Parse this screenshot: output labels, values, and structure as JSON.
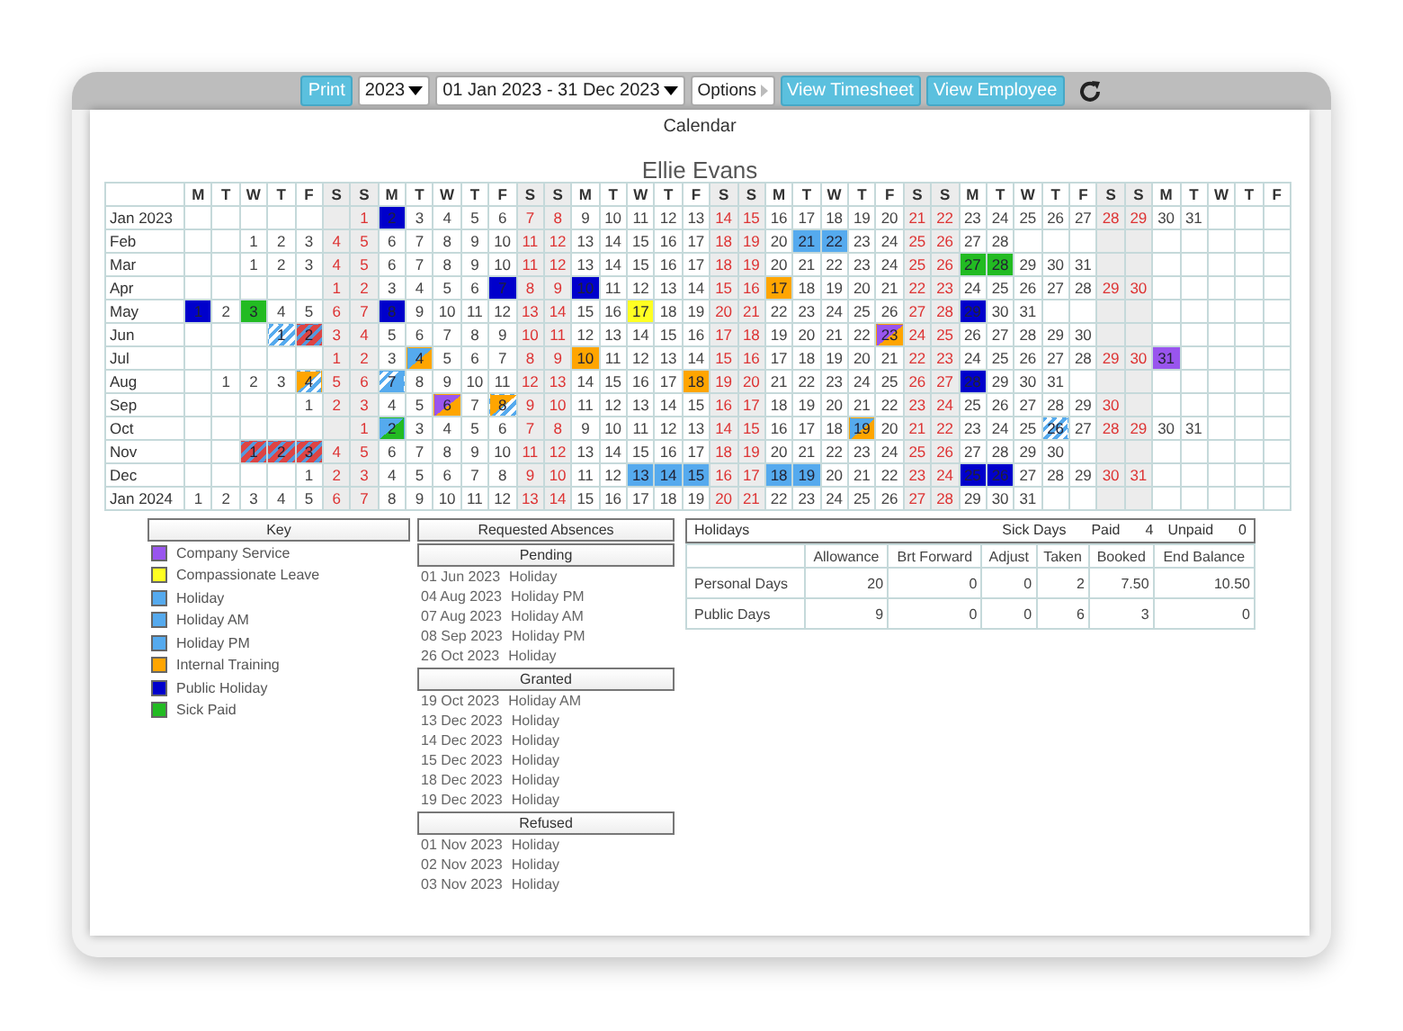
{
  "toolbar": {
    "print": "Print",
    "year": "2023",
    "range": "01 Jan 2023 - 31 Dec 2023",
    "options": "Options",
    "buttons": [
      "View Timesheet",
      "View Employee"
    ]
  },
  "card": {
    "title": "Calendar",
    "employee": "Ellie Evans"
  },
  "calendar": {
    "weekdays": [
      {
        "label": "M",
        "weekend": false
      },
      {
        "label": "T",
        "weekend": false
      },
      {
        "label": "W",
        "weekend": false
      },
      {
        "label": "T",
        "weekend": false
      },
      {
        "label": "F",
        "weekend": false
      },
      {
        "label": "S",
        "weekend": true
      },
      {
        "label": "S",
        "weekend": true
      },
      {
        "label": "M",
        "weekend": false
      },
      {
        "label": "T",
        "weekend": false
      },
      {
        "label": "W",
        "weekend": false
      },
      {
        "label": "T",
        "weekend": false
      },
      {
        "label": "F",
        "weekend": false
      },
      {
        "label": "S",
        "weekend": true
      },
      {
        "label": "S",
        "weekend": true
      },
      {
        "label": "M",
        "weekend": false
      },
      {
        "label": "T",
        "weekend": false
      },
      {
        "label": "W",
        "weekend": false
      },
      {
        "label": "T",
        "weekend": false
      },
      {
        "label": "F",
        "weekend": false
      },
      {
        "label": "S",
        "weekend": true
      },
      {
        "label": "S",
        "weekend": true
      },
      {
        "label": "M",
        "weekend": false
      },
      {
        "label": "T",
        "weekend": false
      },
      {
        "label": "W",
        "weekend": false
      },
      {
        "label": "T",
        "weekend": false
      },
      {
        "label": "F",
        "weekend": false
      },
      {
        "label": "S",
        "weekend": true
      },
      {
        "label": "S",
        "weekend": true
      },
      {
        "label": "M",
        "weekend": false
      },
      {
        "label": "T",
        "weekend": false
      },
      {
        "label": "W",
        "weekend": false
      },
      {
        "label": "T",
        "weekend": false
      },
      {
        "label": "F",
        "weekend": false
      },
      {
        "label": "S",
        "weekend": true
      },
      {
        "label": "S",
        "weekend": true
      },
      {
        "label": "M",
        "weekend": false
      },
      {
        "label": "T",
        "weekend": false
      },
      {
        "label": "W",
        "weekend": false
      },
      {
        "label": "T",
        "weekend": false
      },
      {
        "label": "F",
        "weekend": false
      }
    ],
    "rows": [
      {
        "month": "Jan 2023",
        "cells": [
          {
            "kind": "blank"
          },
          {
            "kind": "blank"
          },
          {
            "kind": "blank"
          },
          {
            "kind": "blank"
          },
          {
            "kind": "blank"
          },
          {
            "kind": "blank"
          },
          "1",
          {
            "day": "2",
            "kind": "public"
          },
          "3",
          "4",
          "5",
          "6",
          "7",
          "8",
          "9",
          "10",
          "11",
          "12",
          "13",
          "14",
          "15",
          "16",
          "17",
          "18",
          "19",
          "20",
          "21",
          "22",
          "23",
          "24",
          "25",
          "26",
          "27",
          "28",
          "29",
          "30",
          "31"
        ]
      },
      {
        "month": "Feb",
        "cells": [
          {
            "kind": "blank"
          },
          {
            "kind": "blank"
          },
          "1",
          "2",
          "3",
          "4",
          "5",
          "6",
          "7",
          "8",
          "9",
          "10",
          "11",
          "12",
          "13",
          "14",
          "15",
          "16",
          "17",
          "18",
          "19",
          "20",
          {
            "day": "21",
            "kind": "holiday"
          },
          {
            "day": "22",
            "kind": "holiday"
          },
          "23",
          "24",
          "25",
          "26",
          "27",
          "28"
        ]
      },
      {
        "month": "Mar",
        "cells": [
          {
            "kind": "blank"
          },
          {
            "kind": "blank"
          },
          "1",
          "2",
          "3",
          "4",
          "5",
          "6",
          "7",
          "8",
          "9",
          "10",
          "11",
          "12",
          "13",
          "14",
          "15",
          "16",
          "17",
          "18",
          "19",
          "20",
          "21",
          "22",
          "23",
          "24",
          "25",
          "26",
          {
            "day": "27",
            "kind": "sick"
          },
          {
            "day": "28",
            "kind": "sick"
          },
          "29",
          "30",
          "31"
        ]
      },
      {
        "month": "Apr",
        "cells": [
          {
            "kind": "blank"
          },
          {
            "kind": "blank"
          },
          {
            "kind": "blank"
          },
          {
            "kind": "blank"
          },
          {
            "kind": "blank"
          },
          "1",
          "2",
          "3",
          "4",
          "5",
          "6",
          {
            "day": "7",
            "kind": "public"
          },
          "8",
          "9",
          {
            "day": "10",
            "kind": "public"
          },
          "11",
          "12",
          "13",
          "14",
          "15",
          "16",
          {
            "day": "17",
            "kind": "training"
          },
          "18",
          "19",
          "20",
          "21",
          "22",
          "23",
          "24",
          "25",
          "26",
          "27",
          "28",
          "29",
          "30"
        ]
      },
      {
        "month": "May",
        "cells": [
          {
            "day": "1",
            "kind": "public"
          },
          "2",
          {
            "day": "3",
            "kind": "sick"
          },
          "4",
          "5",
          "6",
          "7",
          {
            "day": "8",
            "kind": "public"
          },
          "9",
          "10",
          "11",
          "12",
          "13",
          "14",
          "15",
          "16",
          {
            "day": "17",
            "kind": "compassionate"
          },
          "18",
          "19",
          "20",
          "21",
          "22",
          "23",
          "24",
          "25",
          "26",
          "27",
          "28",
          {
            "day": "29",
            "kind": "public"
          },
          "30",
          "31"
        ]
      },
      {
        "month": "Jun",
        "cells": [
          {
            "kind": "blank"
          },
          {
            "kind": "blank"
          },
          {
            "kind": "blank"
          },
          {
            "day": "1",
            "kind": "pending"
          },
          {
            "day": "2",
            "kind": "refused"
          },
          "3",
          "4",
          "5",
          "6",
          "7",
          "8",
          "9",
          "10",
          "11",
          "12",
          "13",
          "14",
          "15",
          "16",
          "17",
          "18",
          "19",
          "20",
          "21",
          "22",
          {
            "day": "23",
            "kind": "split",
            "halves": [
              {
                "kind": "service"
              },
              {
                "kind": "training"
              }
            ]
          },
          "24",
          "25",
          "26",
          "27",
          "28",
          "29",
          "30"
        ]
      },
      {
        "month": "Jul",
        "cells": [
          {
            "kind": "blank"
          },
          {
            "kind": "blank"
          },
          {
            "kind": "blank"
          },
          {
            "kind": "blank"
          },
          {
            "kind": "blank"
          },
          "1",
          "2",
          "3",
          {
            "day": "4",
            "kind": "split",
            "halves": [
              {
                "kind": "holiday"
              },
              {
                "kind": "training"
              }
            ]
          },
          "5",
          "6",
          "7",
          "8",
          "9",
          {
            "day": "10",
            "kind": "training"
          },
          "11",
          "12",
          "13",
          "14",
          "15",
          "16",
          "17",
          "18",
          "19",
          "20",
          "21",
          "22",
          "23",
          "24",
          "25",
          "26",
          "27",
          "28",
          "29",
          "30",
          {
            "day": "31",
            "kind": "service"
          }
        ]
      },
      {
        "month": "Aug",
        "cells": [
          {
            "kind": "blank"
          },
          "1",
          "2",
          "3",
          {
            "day": "4",
            "kind": "split",
            "halves": [
              {
                "kind": "training"
              },
              {
                "kind": "pending"
              }
            ]
          },
          "5",
          "6",
          {
            "day": "7",
            "kind": "split",
            "halves": [
              {
                "kind": "pending"
              },
              {
                "kind": "holiday"
              }
            ]
          },
          "8",
          "9",
          "10",
          "11",
          "12",
          "13",
          "14",
          "15",
          "16",
          "17",
          {
            "day": "18",
            "kind": "training"
          },
          "19",
          "20",
          "21",
          "22",
          "23",
          "24",
          "25",
          "26",
          "27",
          {
            "day": "28",
            "kind": "public"
          },
          "29",
          "30",
          "31"
        ]
      },
      {
        "month": "Sep",
        "cells": [
          {
            "kind": "blank"
          },
          {
            "kind": "blank"
          },
          {
            "kind": "blank"
          },
          {
            "kind": "blank"
          },
          "1",
          "2",
          "3",
          "4",
          "5",
          {
            "day": "6",
            "kind": "split",
            "halves": [
              {
                "kind": "service"
              },
              {
                "kind": "training"
              }
            ]
          },
          "7",
          {
            "day": "8",
            "kind": "split",
            "halves": [
              {
                "kind": "training"
              },
              {
                "kind": "pending"
              }
            ]
          },
          "9",
          "10",
          "11",
          "12",
          "13",
          "14",
          "15",
          "16",
          "17",
          "18",
          "19",
          "20",
          "21",
          "22",
          "23",
          "24",
          "25",
          "26",
          "27",
          "28",
          "29",
          "30"
        ]
      },
      {
        "month": "Oct",
        "cells": [
          {
            "kind": "blank"
          },
          {
            "kind": "blank"
          },
          {
            "kind": "blank"
          },
          {
            "kind": "blank"
          },
          {
            "kind": "blank"
          },
          {
            "kind": "blank"
          },
          "1",
          {
            "day": "2",
            "kind": "split",
            "halves": [
              {
                "kind": "holiday"
              },
              {
                "kind": "sick"
              }
            ]
          },
          "3",
          "4",
          "5",
          "6",
          "7",
          "8",
          "9",
          "10",
          "11",
          "12",
          "13",
          "14",
          "15",
          "16",
          "17",
          "18",
          {
            "day": "19",
            "kind": "split",
            "halves": [
              {
                "kind": "holiday"
              },
              {
                "kind": "training"
              }
            ]
          },
          "20",
          "21",
          "22",
          "23",
          "24",
          "25",
          {
            "day": "26",
            "kind": "pending"
          },
          "27",
          "28",
          "29",
          "30",
          "31"
        ]
      },
      {
        "month": "Nov",
        "cells": [
          {
            "kind": "blank"
          },
          {
            "kind": "blank"
          },
          {
            "day": "1",
            "kind": "refused"
          },
          {
            "day": "2",
            "kind": "refused"
          },
          {
            "day": "3",
            "kind": "refused"
          },
          "4",
          "5",
          "6",
          "7",
          "8",
          "9",
          "10",
          "11",
          "12",
          "13",
          "14",
          "15",
          "16",
          "17",
          "18",
          "19",
          "20",
          "21",
          "22",
          "23",
          "24",
          "25",
          "26",
          "27",
          "28",
          "29",
          "30"
        ]
      },
      {
        "month": "Dec",
        "cells": [
          {
            "kind": "blank"
          },
          {
            "kind": "blank"
          },
          {
            "kind": "blank"
          },
          {
            "kind": "blank"
          },
          "1",
          "2",
          "3",
          "4",
          "5",
          "6",
          "7",
          "8",
          "9",
          "10",
          "11",
          "12",
          {
            "day": "13",
            "kind": "holiday"
          },
          {
            "day": "14",
            "kind": "holiday"
          },
          {
            "day": "15",
            "kind": "holiday"
          },
          "16",
          "17",
          {
            "day": "18",
            "kind": "holiday"
          },
          {
            "day": "19",
            "kind": "holiday"
          },
          "20",
          "21",
          "22",
          "23",
          "24",
          {
            "day": "25",
            "kind": "public"
          },
          {
            "day": "26",
            "kind": "public"
          },
          "27",
          "28",
          "29",
          "30",
          "31"
        ]
      },
      {
        "month": "Jan 2024",
        "cells": [
          "1",
          "2",
          "3",
          "4",
          "5",
          "6",
          "7",
          "8",
          "9",
          "10",
          "11",
          "12",
          "13",
          "14",
          "15",
          "16",
          "17",
          "18",
          "19",
          "20",
          "21",
          "22",
          "23",
          "24",
          "25",
          "26",
          "27",
          "28",
          "29",
          "30",
          "31"
        ]
      }
    ]
  },
  "key": {
    "title": "Key",
    "items": [
      {
        "label": "Company Service",
        "color": "#9955ee"
      },
      {
        "label": "Compassionate Leave",
        "color": "#ffff22"
      },
      {
        "label": "Holiday",
        "color": "#55aaee"
      },
      {
        "label": "Holiday AM",
        "color": "#55aaee"
      },
      {
        "label": "Holiday PM",
        "color": "#55aaee"
      },
      {
        "label": "Internal Training",
        "color": "#ffa500"
      },
      {
        "label": "Public Holiday",
        "color": "#0000cc"
      },
      {
        "label": "Sick Paid",
        "color": "#22bb22"
      }
    ]
  },
  "requests": {
    "title": "Requested Absences",
    "sections": [
      {
        "heading": "Pending",
        "items": [
          {
            "date": "01 Jun 2023",
            "type": "Holiday"
          },
          {
            "date": "04 Aug 2023",
            "type": "Holiday PM"
          },
          {
            "date": "07 Aug 2023",
            "type": "Holiday AM"
          },
          {
            "date": "08 Sep 2023",
            "type": "Holiday PM"
          },
          {
            "date": "26 Oct 2023",
            "type": "Holiday"
          }
        ]
      },
      {
        "heading": "Granted",
        "items": [
          {
            "date": "19 Oct 2023",
            "type": "Holiday AM"
          },
          {
            "date": "13 Dec 2023",
            "type": "Holiday"
          },
          {
            "date": "14 Dec 2023",
            "type": "Holiday"
          },
          {
            "date": "15 Dec 2023",
            "type": "Holiday"
          },
          {
            "date": "18 Dec 2023",
            "type": "Holiday"
          },
          {
            "date": "19 Dec 2023",
            "type": "Holiday"
          }
        ]
      },
      {
        "heading": "Refused",
        "items": [
          {
            "date": "01 Nov 2023",
            "type": "Holiday"
          },
          {
            "date": "02 Nov 2023",
            "type": "Holiday"
          },
          {
            "date": "03 Nov 2023",
            "type": "Holiday"
          }
        ]
      }
    ]
  },
  "balances": {
    "title": "Holidays",
    "sick_label": "Sick Days",
    "paid_label": "Paid",
    "paid": "4",
    "unpaid_label": "Unpaid",
    "unpaid": "0",
    "columns": [
      "Allowance",
      "Brt Forward",
      "Adjust",
      "Taken",
      "Booked",
      "End Balance"
    ],
    "rows": [
      {
        "label": "Personal Days",
        "values": [
          "20",
          "0",
          "0",
          "2",
          "7.50",
          "10.50"
        ]
      },
      {
        "label": "Public Days",
        "values": [
          "9",
          "0",
          "0",
          "6",
          "3",
          "0"
        ]
      }
    ]
  }
}
